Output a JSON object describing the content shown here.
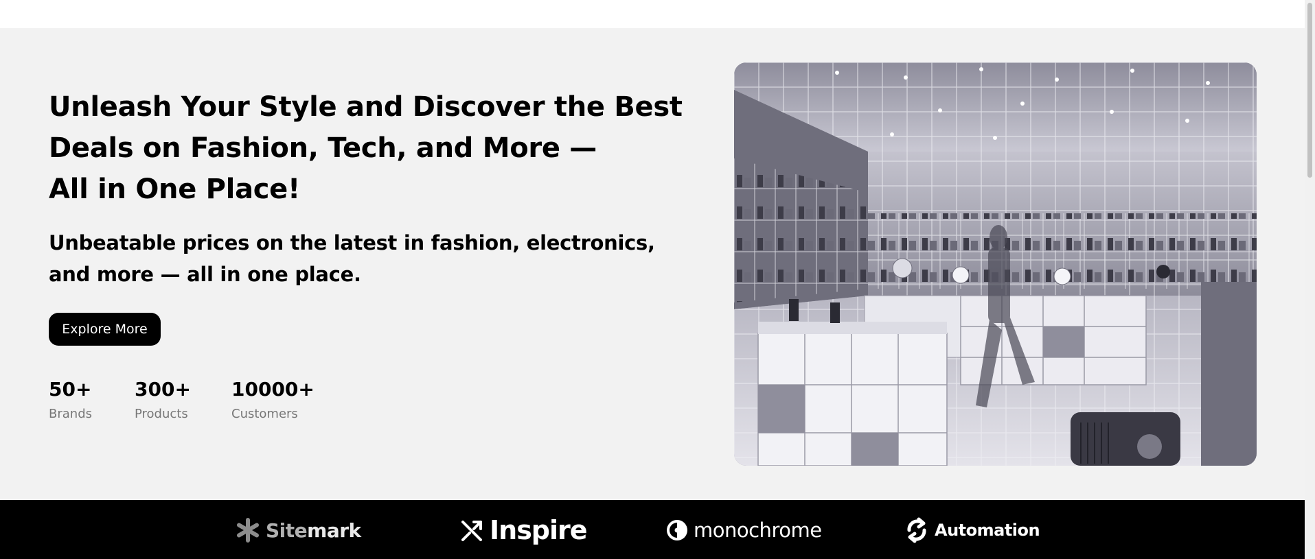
{
  "hero": {
    "title_lines": [
      "Unleash Your Style and Discover the Best",
      "Deals on Fashion, Tech, and More —",
      "All in One Place!"
    ],
    "subtitle_lines": [
      "Unbeatable prices on the latest in fashion, electronics,",
      "and more — all in one place."
    ],
    "cta_label": "Explore More",
    "stats": [
      {
        "value": "50+",
        "label": "Brands"
      },
      {
        "value": "300+",
        "label": "Products"
      },
      {
        "value": "10000+",
        "label": "Customers"
      }
    ]
  },
  "brands": [
    {
      "name_light": "Site",
      "name_bold": "mark",
      "icon": "asterisk-logo-icon"
    },
    {
      "name": "Inspire",
      "icon": "shuffle-logo-icon"
    },
    {
      "name": "monochrome",
      "icon": "half-circle-logo-icon"
    },
    {
      "name": "Automation",
      "icon": "refresh-logo-icon"
    }
  ],
  "colors": {
    "hero_bg": "#f2f2f2",
    "accent": "#000000",
    "brand_bar": "#000000",
    "muted_text": "#777777"
  }
}
